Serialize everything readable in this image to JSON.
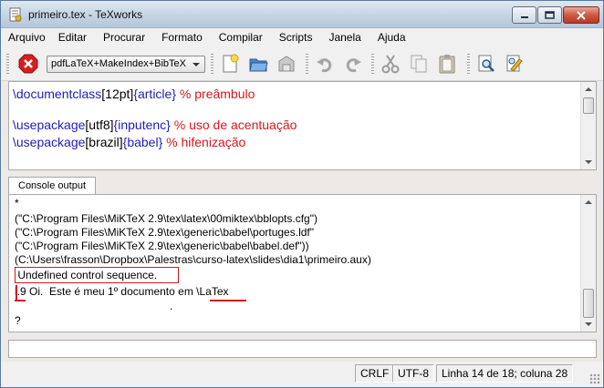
{
  "window": {
    "title": "primeiro.tex - TeXworks",
    "app_icon": "texworks-app-icon",
    "controls": [
      "minimize-icon",
      "maximize-icon",
      "close-icon"
    ]
  },
  "menubar": {
    "items": [
      "Arquivo",
      "Editar",
      "Procurar",
      "Formato",
      "Compilar",
      "Scripts",
      "Janela",
      "Ajuda"
    ]
  },
  "toolbar": {
    "stop_icon": "stop-typeset-icon",
    "engine": "pdfLaTeX+MakeIndex+BibTeX",
    "buttons": [
      "new-document-icon",
      "open-folder-icon",
      "save-icon",
      "undo-icon",
      "redo-icon",
      "cut-icon",
      "copy-icon",
      "paste-icon",
      "find-icon",
      "replace-icon"
    ]
  },
  "editor": {
    "lines": [
      {
        "cmd": "\\documentclass",
        "opt": "[12pt]",
        "arg": "{article}",
        "comment": " % preâmbulo"
      },
      {
        "cmd": "\\usepackage",
        "opt": "[utf8]",
        "arg": "{inputenc}",
        "comment": " % uso de acentuação"
      },
      {
        "cmd": "\\usepackage",
        "opt": "[brazil]",
        "arg": "{babel}",
        "comment": " % hifenização"
      }
    ]
  },
  "console": {
    "tab_label": "Console output",
    "lines": [
      "*",
      "(\"C:\\Program Files\\MiKTeX 2.9\\tex\\latex\\00miktex\\bblopts.cfg\")",
      "(\"C:\\Program Files\\MiKTeX 2.9\\tex\\generic\\babel\\portuges.ldf\"",
      "(\"C:\\Program Files\\MiKTeX 2.9\\tex\\generic\\babel\\babel.def\"))",
      "(C:\\Users\\frasson\\Dropbox\\Palestras\\curso-latex\\slides\\dia1\\primeiro.aux)",
      " Undefined control sequence.",
      "l.9 Oi.  Este é meu 1º documento em \\LaTex",
      "                                                   .",
      "?"
    ]
  },
  "input": {
    "value": ""
  },
  "status": {
    "line_ending": "CRLF",
    "encoding": "UTF-8",
    "position": "Linha 14 de 18; coluna 28"
  },
  "colors": {
    "command": "#1f1fb4",
    "comment": "#d4171e",
    "error_highlight": "#d4171e"
  }
}
